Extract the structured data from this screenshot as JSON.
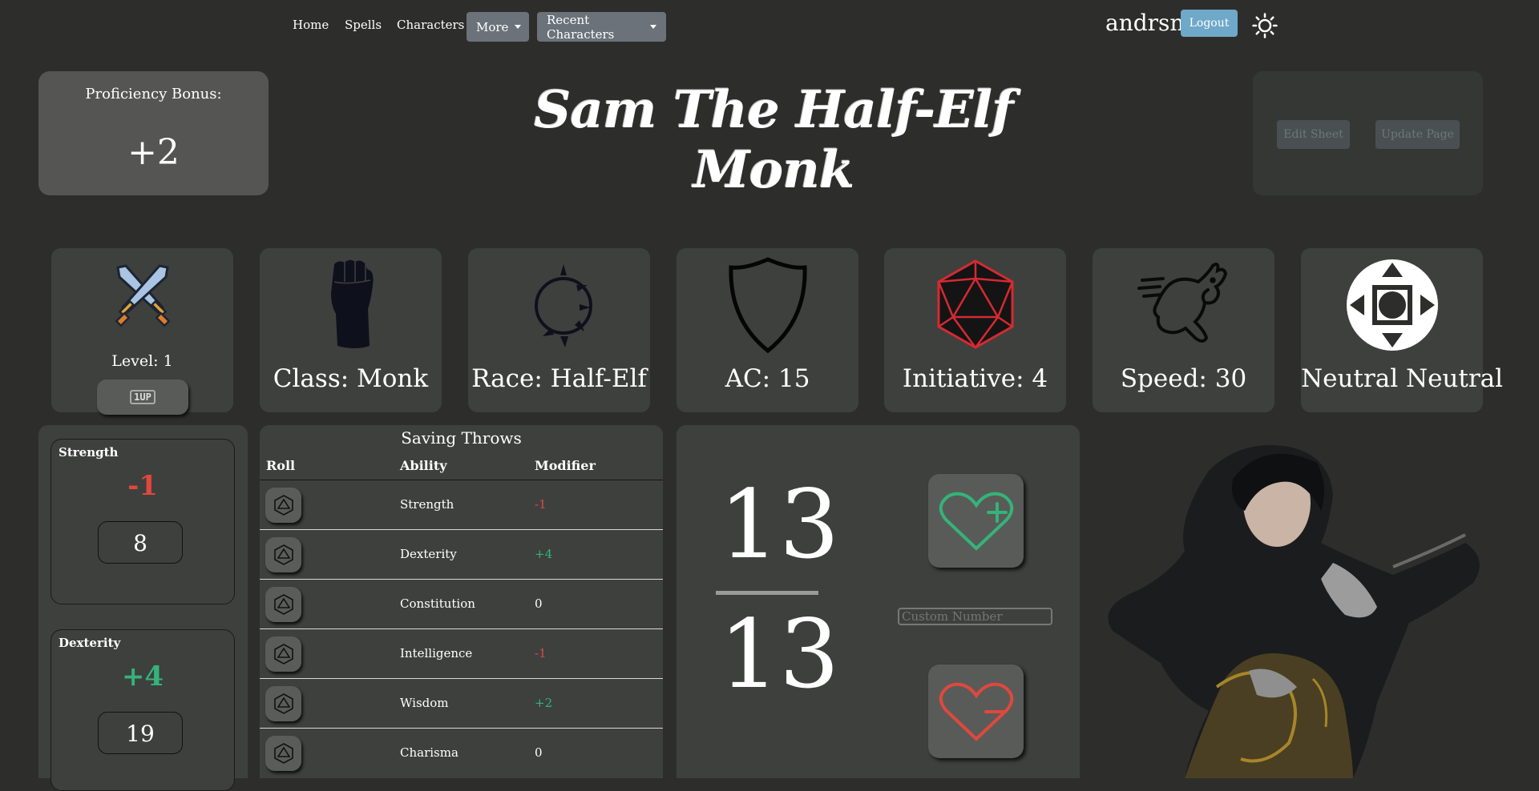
{
  "nav": {
    "home": "Home",
    "spells": "Spells",
    "characters": "Characters",
    "more": "More",
    "recent": "Recent Characters",
    "username": "andrsn",
    "logout": "Logout"
  },
  "proficiency": {
    "label": "Proficiency Bonus:",
    "value": "+2"
  },
  "title": "Sam The Half-Elf Monk",
  "actions": {
    "edit": "Edit Sheet",
    "update": "Update Page"
  },
  "stats": {
    "level": "Level: 1",
    "level_up_label": "1UP",
    "class": "Class: Monk",
    "race": "Race: Half-Elf",
    "ac": "AC: 15",
    "initiative": "Initiative: 4",
    "speed": "Speed: 30",
    "alignment": "Neutral Neutral"
  },
  "abilities": [
    {
      "name": "Strength",
      "mod": "-1",
      "score": "8"
    },
    {
      "name": "Dexterity",
      "mod": "+4",
      "score": "19"
    }
  ],
  "saving_throws": {
    "title": "Saving Throws",
    "headers": [
      "Roll",
      "Ability",
      "Modifier"
    ],
    "rows": [
      {
        "ability": "Strength",
        "mod": "-1"
      },
      {
        "ability": "Dexterity",
        "mod": "+4"
      },
      {
        "ability": "Constitution",
        "mod": "0"
      },
      {
        "ability": "Intelligence",
        "mod": "-1"
      },
      {
        "ability": "Wisdom",
        "mod": "+2"
      },
      {
        "ability": "Charisma",
        "mod": "0"
      }
    ]
  },
  "hp": {
    "current": "13",
    "max": "13",
    "custom_placeholder": "Custom Number"
  },
  "colors": {
    "negative": "#e0483d",
    "positive": "#34b37a",
    "accent": "#6fa8c9"
  }
}
